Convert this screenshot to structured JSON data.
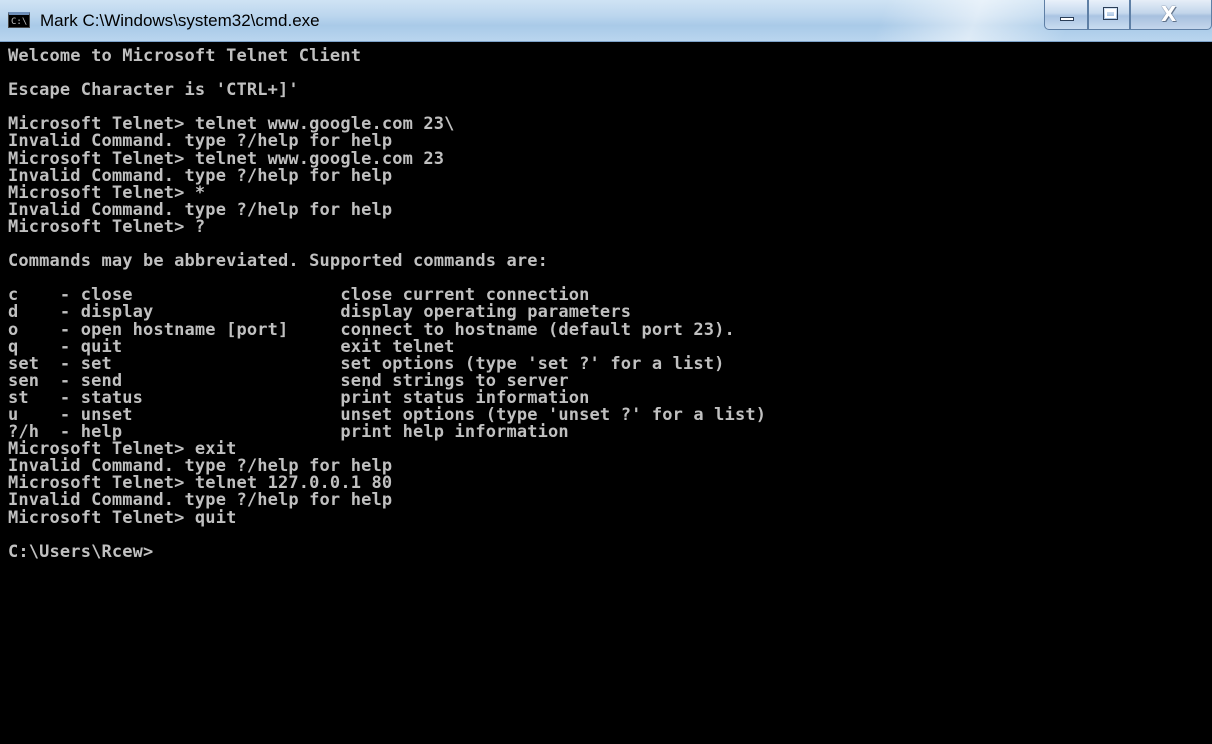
{
  "window": {
    "title": "Mark C:\\Windows\\system32\\cmd.exe",
    "icon": "cmd-icon",
    "icon_text": "C:\\",
    "buttons": {
      "minimize": "minimize-icon",
      "maximize": "maximize-icon",
      "close": "X"
    },
    "colors": {
      "titlebar": "#b9d5ee",
      "console_bg": "#000000",
      "console_text": "#c0c0c0"
    }
  },
  "console": {
    "lines": [
      "Welcome to Microsoft Telnet Client",
      "",
      "Escape Character is 'CTRL+]'",
      "",
      "Microsoft Telnet> telnet www.google.com 23\\",
      "Invalid Command. type ?/help for help",
      "Microsoft Telnet> telnet www.google.com 23",
      "Invalid Command. type ?/help for help",
      "Microsoft Telnet> *",
      "Invalid Command. type ?/help for help",
      "Microsoft Telnet> ?",
      "",
      "Commands may be abbreviated. Supported commands are:",
      "",
      "c    - close                    close current connection",
      "d    - display                  display operating parameters",
      "o    - open hostname [port]     connect to hostname (default port 23).",
      "q    - quit                     exit telnet",
      "set  - set                      set options (type 'set ?' for a list)",
      "sen  - send                     send strings to server",
      "st   - status                   print status information",
      "u    - unset                    unset options (type 'unset ?' for a list)",
      "?/h  - help                     print help information",
      "Microsoft Telnet> exit",
      "Invalid Command. type ?/help for help",
      "Microsoft Telnet> telnet 127.0.0.1 80",
      "Invalid Command. type ?/help for help",
      "Microsoft Telnet> quit",
      "",
      "C:\\Users\\Rcew>"
    ]
  }
}
